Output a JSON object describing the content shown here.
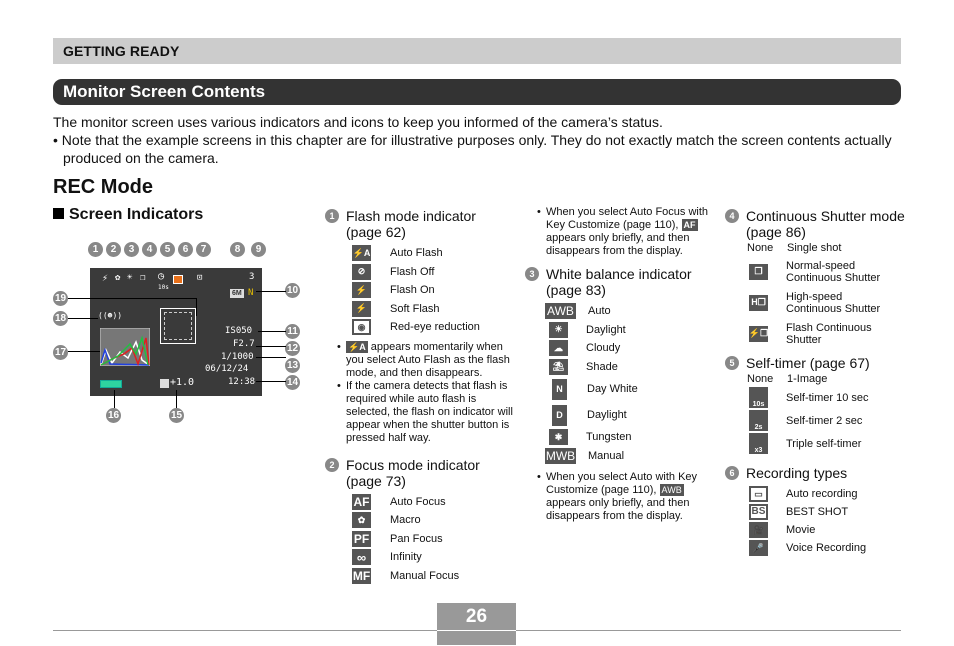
{
  "section": "GETTING READY",
  "title": "Monitor Screen Contents",
  "intro": {
    "p1": "The monitor screen uses various indicators and icons to keep you informed of the camera’s status.",
    "p2": "• Note that the example screens in this chapter are for illustrative purposes only. They do not exactly match the screen contents actually produced on the camera."
  },
  "rec_mode": "REC Mode",
  "screen_indicators": "Screen Indicators",
  "monitor": {
    "callouts": [
      "1",
      "2",
      "3",
      "4",
      "5",
      "6",
      "7",
      "8",
      "9",
      "10",
      "11",
      "12",
      "13",
      "14",
      "15",
      "16",
      "17",
      "18",
      "19"
    ],
    "shots_remaining": "3",
    "image_size": "6M",
    "quality": "N",
    "timer_label": "10s",
    "iso": "IS050",
    "aperture": "F2.7",
    "shutter": "1/1000",
    "date": "06/12/24",
    "time": "12:38",
    "ev": "+1.0"
  },
  "flash": {
    "num": "1",
    "heading": "Flash mode indicator (page 62)",
    "items": [
      {
        "icon": "⚡A",
        "label": "Auto Flash"
      },
      {
        "icon": "⊘",
        "label": "Flash Off"
      },
      {
        "icon": "⚡",
        "label": "Flash On"
      },
      {
        "icon": "⚡",
        "label": "Soft Flash"
      },
      {
        "icon": "◉",
        "label": "Red-eye reduction"
      }
    ],
    "note1_icon": "⚡A",
    "note1": " appears momentarily when you select Auto Flash as the flash mode, and then disappears.",
    "note2": "If the camera detects that flash is required while auto flash is selected, the flash on indicator will appear when the shutter button is pressed half way."
  },
  "focus": {
    "num": "2",
    "heading": "Focus mode indicator (page 73)",
    "items": [
      {
        "icon": "AF",
        "label": "Auto Focus"
      },
      {
        "icon": "✿",
        "label": "Macro"
      },
      {
        "icon": "PF",
        "label": "Pan Focus"
      },
      {
        "icon": "∞",
        "label": "Infinity"
      },
      {
        "icon": "MF",
        "label": "Manual Focus"
      }
    ],
    "note_pre": "When you select Auto Focus with Key Customize (page 110), ",
    "note_icon": "AF",
    "note_post": " appears only briefly, and then disappears from the display."
  },
  "wb": {
    "num": "3",
    "heading": "White balance indicator (page 83)",
    "items": [
      {
        "icon": "AWB",
        "label": "Auto"
      },
      {
        "icon": "☀",
        "label": "Daylight"
      },
      {
        "icon": "☁",
        "label": "Cloudy"
      },
      {
        "icon": "⛱",
        "label": "Shade"
      },
      {
        "icon": "N",
        "label": "Day White"
      },
      {
        "icon": "D",
        "label": "Daylight"
      },
      {
        "icon": "✱",
        "label": "Tungsten"
      },
      {
        "icon": "MWB",
        "label": "Manual"
      }
    ],
    "note_pre": "When you select Auto with Key Customize (page 110), ",
    "note_icon": "AWB",
    "note_post": " appears only briefly, and then disappears from the display."
  },
  "continuous": {
    "num": "4",
    "heading": "Continuous Shutter mode (page 86)",
    "none": "None",
    "none_label": "Single shot",
    "items": [
      {
        "icon": "❐",
        "label": "Normal-speed Continuous Shutter"
      },
      {
        "icon": "H❐",
        "label": "High-speed Continuous Shutter"
      },
      {
        "icon": "⚡❐",
        "label": "Flash Continuous Shutter"
      }
    ]
  },
  "timer": {
    "num": "5",
    "heading": "Self-timer (page 67)",
    "none": "None",
    "none_label": "1-Image",
    "items": [
      {
        "icon": "10s",
        "label": "Self-timer 10 sec"
      },
      {
        "icon": "2s",
        "label": "Self-timer 2 sec"
      },
      {
        "icon": "x3",
        "label": "Triple self-timer"
      }
    ]
  },
  "rectypes": {
    "num": "6",
    "heading": "Recording types",
    "items": [
      {
        "icon": "▭",
        "label": "Auto recording"
      },
      {
        "icon": "BS",
        "label": "BEST SHOT"
      },
      {
        "icon": "🎥",
        "label": "Movie"
      },
      {
        "icon": "🎤",
        "label": "Voice Recording"
      }
    ]
  },
  "page_number": "26"
}
